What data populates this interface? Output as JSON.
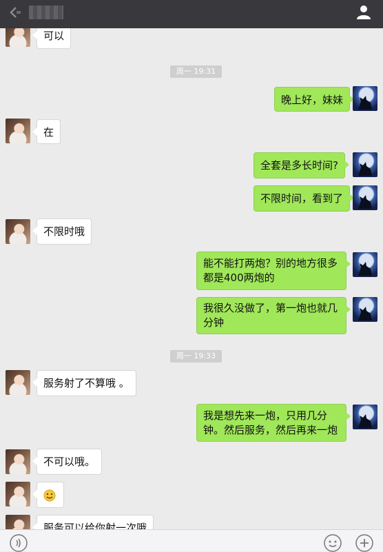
{
  "header": {
    "title": "",
    "back_icon": "back-arrow-icon",
    "profile_icon": "person-icon"
  },
  "colors": {
    "topbar": "#39383d",
    "chat_bg": "#ebebeb",
    "sent_bubble": "#a0e75a",
    "received_bubble": "#ffffff",
    "timestamp_bg": "#cfcfcf"
  },
  "messages": [
    {
      "side": "left",
      "text": "可以"
    },
    {
      "type": "timestamp",
      "text": "周一 19:31"
    },
    {
      "side": "right",
      "text": "晚上好，妹妹"
    },
    {
      "side": "left",
      "text": "在"
    },
    {
      "side": "right",
      "text": "全套是多长时间?"
    },
    {
      "side": "right",
      "text": "不限时间，看到了"
    },
    {
      "side": "left",
      "text": "不限时哦"
    },
    {
      "side": "right",
      "line1": "能不能打两炮？别的地方很多",
      "line2": "都是400两炮的"
    },
    {
      "side": "right",
      "line1": "我很久没做了，第一炮也就几",
      "line2": "分钟"
    },
    {
      "type": "timestamp",
      "text": "周一 19:33"
    },
    {
      "side": "left",
      "text": "服务射了不算哦 。"
    },
    {
      "side": "right",
      "line1": "我是想先来一炮，只用几分",
      "line2": "钟。然后服务，然后再来一炮"
    },
    {
      "side": "left",
      "text": "不可以哦。"
    },
    {
      "side": "left",
      "emoji": "smile-emoji-icon"
    },
    {
      "side": "left",
      "text": "服务可以给你射一次哦"
    }
  ],
  "input_bar": {
    "voice_icon": "voice-icon",
    "emoji_icon": "emoji-icon",
    "plus_icon": "plus-icon"
  }
}
